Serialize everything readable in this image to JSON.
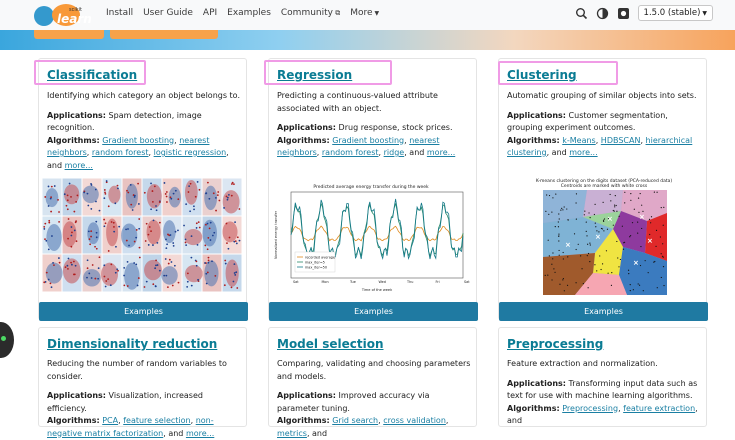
{
  "nav": {
    "logo_small": "scikit",
    "logo_big": "learn",
    "links": [
      "Install",
      "User Guide",
      "API",
      "Examples",
      "Community",
      "More"
    ],
    "version": "1.5.0 (stable)"
  },
  "cards": [
    {
      "title": "Classification",
      "desc": "Identifying which category an object belongs to.",
      "apps_label": "Applications:",
      "apps": "Spam detection, image recognition.",
      "algs_label": "Algorithms:",
      "algs": [
        "Gradient boosting",
        "nearest neighbors",
        "random forest",
        "logistic regression"
      ],
      "algs_tail": ", and ",
      "more": "more...",
      "button": "Examples"
    },
    {
      "title": "Regression",
      "desc": "Predicting a continuous-valued attribute associated with an object.",
      "apps_label": "Applications:",
      "apps": "Drug response, stock prices.",
      "algs_label": "Algorithms:",
      "algs": [
        "Gradient boosting",
        "nearest neighbors",
        "random forest",
        "ridge"
      ],
      "algs_tail": ", and ",
      "more": "more...",
      "button": "Examples",
      "plot_title": "Predicted average energy transfer during the week",
      "plot_ylabel": "Normalized energy transfer",
      "plot_xlabel": "Time of the week",
      "plot_legend": [
        "recorded average",
        "max_iter=5",
        "max_iter=50"
      ],
      "plot_days": [
        "Sat",
        "Mon",
        "Tue",
        "Wed",
        "Thu",
        "Fri",
        "Sat"
      ]
    },
    {
      "title": "Clustering",
      "desc": "Automatic grouping of similar objects into sets.",
      "apps_label": "Applications:",
      "apps": "Customer segmentation, grouping experiment outcomes.",
      "algs_label": "Algorithms:",
      "algs": [
        "k-Means",
        "HDBSCAN",
        "hierarchical clustering"
      ],
      "algs_tail": ", and ",
      "more": "more...",
      "button": "Examples",
      "plot_title": "K-means clustering on the digits dataset (PCA-reduced data)",
      "plot_subtitle": "Centroids are marked with white cross"
    },
    {
      "title": "Dimensionality reduction",
      "desc": "Reducing the number of random variables to consider.",
      "apps_label": "Applications:",
      "apps": "Visualization, increased efficiency.",
      "algs_label": "Algorithms:",
      "algs": [
        "PCA",
        "feature selection",
        "non-negative matrix factorization"
      ],
      "algs_tail": ", and ",
      "more": "more..."
    },
    {
      "title": "Model selection",
      "desc": "Comparing, validating and choosing parameters and models.",
      "apps_label": "Applications:",
      "apps": "Improved accuracy via parameter tuning.",
      "algs_label": "Algorithms:",
      "algs": [
        "Grid search",
        "cross validation",
        "metrics"
      ],
      "algs_tail": ", and"
    },
    {
      "title": "Preprocessing",
      "desc": "Feature extraction and normalization.",
      "apps_label": "Applications:",
      "apps": "Transforming input data such as text for use with machine learning algorithms.",
      "algs_label": "Algorithms:",
      "algs": [
        "Preprocessing",
        "feature extraction"
      ],
      "algs_tail": ", and"
    }
  ]
}
